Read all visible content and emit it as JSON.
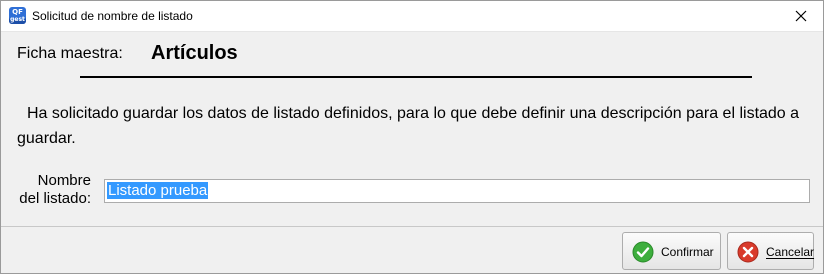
{
  "window": {
    "title": "Solicitud de nombre de listado",
    "icon_text_top": "QF",
    "icon_text_bottom": "gest"
  },
  "header": {
    "ficha_label": "Ficha maestra:",
    "ficha_value": "Artículos"
  },
  "message": "Ha solicitado guardar los datos de listado definidos, para lo que debe definir una descripción para el listado a guardar.",
  "form": {
    "name_label_line1": "Nombre",
    "name_label_line2": "del listado:",
    "name_value": "Listado prueba"
  },
  "buttons": {
    "confirm": "Confirmar",
    "cancel": "Cancelar"
  },
  "colors": {
    "selection": "#3399ff",
    "confirm_icon": "#3dae3d",
    "cancel_icon": "#d93a2b"
  },
  "icons": {
    "app": "qf-gest-app-icon",
    "close": "close-icon",
    "confirm": "check-icon",
    "cancel": "cancel-icon"
  }
}
